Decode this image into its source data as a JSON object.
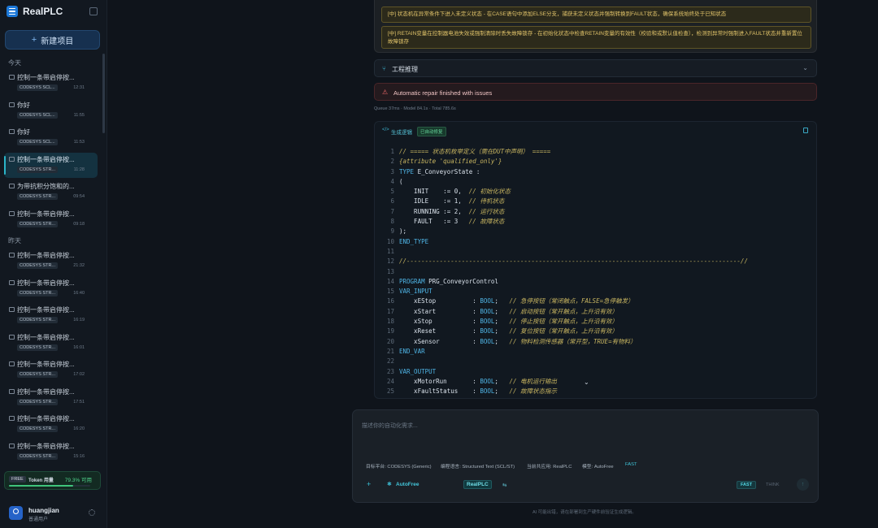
{
  "app": {
    "name": "RealPLC",
    "new_project_label": "新建项目"
  },
  "history": {
    "sections": [
      {
        "label": "今天",
        "items": [
          {
            "title": "控制一条带启停按...",
            "tag": "CODESYS SCL...",
            "time": "12:31",
            "active": false
          },
          {
            "title": "你好",
            "tag": "CODESYS SCL...",
            "time": "11:55",
            "active": false
          },
          {
            "title": "你好",
            "tag": "CODESYS SCL...",
            "time": "11:53",
            "active": false
          },
          {
            "title": "控制一条带启停按...",
            "tag": "CODESYS STR...",
            "time": "11:28",
            "active": true
          },
          {
            "title": "为带抗积分饱和的...",
            "tag": "CODESYS STR...",
            "time": "09:54",
            "active": false
          },
          {
            "title": "控制一条带启停按...",
            "tag": "CODESYS STR...",
            "time": "09:18",
            "active": false
          }
        ]
      },
      {
        "label": "昨天",
        "items": [
          {
            "title": "控制一条带启停按...",
            "tag": "CODESYS STR...",
            "time": "21:32",
            "active": false
          },
          {
            "title": "控制一条带启停按...",
            "tag": "CODESYS STR...",
            "time": "16:40",
            "active": false
          },
          {
            "title": "控制一条带启停按...",
            "tag": "CODESYS STR...",
            "time": "16:19",
            "active": false
          },
          {
            "title": "控制一条带启停按...",
            "tag": "CODESYS STR...",
            "time": "16:01",
            "active": false
          },
          {
            "title": "控制一条带启停按...",
            "tag": "CODESYS STR...",
            "time": "17:02",
            "active": false
          },
          {
            "title": "控制一条带启停按...",
            "tag": "CODESYS STR...",
            "time": "17:51",
            "active": false
          },
          {
            "title": "控制一条带启停按...",
            "tag": "CODESYS STR...",
            "time": "16:20",
            "active": false
          },
          {
            "title": "控制一条带启停按...",
            "tag": "CODESYS STR...",
            "time": "15:16",
            "active": false
          }
        ]
      }
    ]
  },
  "token": {
    "plan": "FREE",
    "label": "Token 用量",
    "percent_text": "79.3% 可用",
    "available_fraction": 0.793
  },
  "user": {
    "name": "huangjian",
    "role": "普通用户"
  },
  "warnings": [
    "[中] 状态机在异常条件下进入未定义状态 - 在CASE语句中添加ELSE分支，捕获未定义状态并强制转换到FAULT状态，确保系统始终处于已知状态",
    "[中] RETAIN变量在控制器电池失效或强制清除时丢失故障锁存 - 在初始化状态中检查RETAIN变量的有效性（校验和或默认值检查），检测到异常时强制进入FAULT状态并重新置位故障锁存"
  ],
  "engineering": {
    "label": "工程推理"
  },
  "repair": {
    "text": "Automatic repair finished with issues"
  },
  "stats": {
    "text": "Queue 37ms · Model 84.1s · Total 785.6s"
  },
  "code_panel": {
    "title": "生成逻辑",
    "badge": "已自动修复",
    "lines": [
      {
        "n": "1",
        "segs": [
          {
            "t": "// ===== 状态机枚举定义（需在DUT中声明） =====",
            "c": "cm"
          }
        ]
      },
      {
        "n": "2",
        "segs": [
          {
            "t": "{attribute 'qualified_only'}",
            "c": "cm"
          }
        ]
      },
      {
        "n": "3",
        "segs": [
          {
            "t": "TYPE",
            "c": "kw"
          },
          {
            "t": " E_ConveyorState :",
            "c": "id"
          }
        ]
      },
      {
        "n": "4",
        "segs": [
          {
            "t": "(",
            "c": "id"
          }
        ]
      },
      {
        "n": "5",
        "segs": [
          {
            "t": "    INIT    := 0,  ",
            "c": "id"
          },
          {
            "t": "// 初始化状态",
            "c": "cm"
          }
        ]
      },
      {
        "n": "6",
        "segs": [
          {
            "t": "    IDLE    := 1,  ",
            "c": "id"
          },
          {
            "t": "// 待机状态",
            "c": "cm"
          }
        ]
      },
      {
        "n": "7",
        "segs": [
          {
            "t": "    RUNNING := 2,  ",
            "c": "id"
          },
          {
            "t": "// 运行状态",
            "c": "cm"
          }
        ]
      },
      {
        "n": "8",
        "segs": [
          {
            "t": "    FAULT   := 3   ",
            "c": "id"
          },
          {
            "t": "// 故障状态",
            "c": "cm"
          }
        ]
      },
      {
        "n": "9",
        "segs": [
          {
            "t": ");",
            "c": "id"
          }
        ]
      },
      {
        "n": "10",
        "segs": [
          {
            "t": "END_TYPE",
            "c": "kw"
          }
        ]
      },
      {
        "n": "11",
        "segs": [
          {
            "t": "",
            "c": "id"
          }
        ]
      },
      {
        "n": "12",
        "segs": [
          {
            "t": "//-------------------------------------------------------------------------------------------//",
            "c": "cm"
          }
        ]
      },
      {
        "n": "13",
        "segs": [
          {
            "t": "",
            "c": "id"
          }
        ]
      },
      {
        "n": "14",
        "segs": [
          {
            "t": "PROGRAM",
            "c": "kw"
          },
          {
            "t": " PRG_ConveyorControl",
            "c": "id"
          }
        ]
      },
      {
        "n": "15",
        "segs": [
          {
            "t": "VAR_INPUT",
            "c": "kw"
          }
        ]
      },
      {
        "n": "16",
        "segs": [
          {
            "t": "    xEStop          : ",
            "c": "id"
          },
          {
            "t": "BOOL",
            "c": "ty"
          },
          {
            "t": ";   ",
            "c": "id"
          },
          {
            "t": "// 急停按钮（常闭触点，FALSE=急停触发）",
            "c": "cm"
          }
        ]
      },
      {
        "n": "17",
        "segs": [
          {
            "t": "    xStart          : ",
            "c": "id"
          },
          {
            "t": "BOOL",
            "c": "ty"
          },
          {
            "t": ";   ",
            "c": "id"
          },
          {
            "t": "// 启动按钮（常开触点，上升沿有效）",
            "c": "cm"
          }
        ]
      },
      {
        "n": "18",
        "segs": [
          {
            "t": "    xStop           : ",
            "c": "id"
          },
          {
            "t": "BOOL",
            "c": "ty"
          },
          {
            "t": ";   ",
            "c": "id"
          },
          {
            "t": "// 停止按钮（常开触点，上升沿有效）",
            "c": "cm"
          }
        ]
      },
      {
        "n": "19",
        "segs": [
          {
            "t": "    xReset          : ",
            "c": "id"
          },
          {
            "t": "BOOL",
            "c": "ty"
          },
          {
            "t": ";   ",
            "c": "id"
          },
          {
            "t": "// 复位按钮（常开触点，上升沿有效）",
            "c": "cm"
          }
        ]
      },
      {
        "n": "20",
        "segs": [
          {
            "t": "    xSensor         : ",
            "c": "id"
          },
          {
            "t": "BOOL",
            "c": "ty"
          },
          {
            "t": ";   ",
            "c": "id"
          },
          {
            "t": "// 物料检测传感器（常开型，TRUE=有物料）",
            "c": "cm"
          }
        ]
      },
      {
        "n": "21",
        "segs": [
          {
            "t": "END_VAR",
            "c": "kw"
          }
        ]
      },
      {
        "n": "22",
        "segs": [
          {
            "t": "",
            "c": "id"
          }
        ]
      },
      {
        "n": "23",
        "segs": [
          {
            "t": "VAR_OUTPUT",
            "c": "kw"
          }
        ]
      },
      {
        "n": "24",
        "segs": [
          {
            "t": "    xMotorRun       : ",
            "c": "id"
          },
          {
            "t": "BOOL",
            "c": "ty"
          },
          {
            "t": ";   ",
            "c": "id"
          },
          {
            "t": "// 电机运行输出",
            "c": "cm"
          }
        ]
      },
      {
        "n": "25",
        "segs": [
          {
            "t": "    xFaultStatus    : ",
            "c": "id"
          },
          {
            "t": "BOOL",
            "c": "ty"
          },
          {
            "t": ";   ",
            "c": "id"
          },
          {
            "t": "// 故障状态指示",
            "c": "cm"
          }
        ]
      }
    ]
  },
  "composer": {
    "placeholder": "描述你的自动化需求...",
    "meta": [
      {
        "key": "target",
        "text": "目标平台: CODESYS (Generic)"
      },
      {
        "key": "language",
        "text": "编程语言: Structured Text (SCL/ST)"
      },
      {
        "key": "app",
        "text": "当前共应用: RealPLC"
      },
      {
        "key": "model",
        "text": "模型: AutoFree"
      },
      {
        "key": "speed",
        "text": "FAST"
      }
    ],
    "model_name": "AutoFree",
    "platform_chip": "RealPLC",
    "fast_label": "FAST",
    "think_label": "THINK"
  },
  "footer": {
    "disclaimer": "AI 可能出错，请在部署到生产硬件前验证生成逻辑。"
  },
  "colors": {
    "keyword": "#4fb5e6",
    "comment": "#c8b560",
    "type": "#4fb5e6",
    "ident": "#d9e1ea",
    "accent": "#2bb5c8",
    "warning": "#e2c46a",
    "error": "#f06b6b"
  },
  "icons": [
    "brand-logo",
    "collapse-sidebar-icon",
    "plus-icon",
    "chat-icon",
    "gear-icon",
    "branch-icon",
    "chevron-down-icon",
    "alert-icon",
    "code-icon",
    "copy-icon",
    "sparkle-icon",
    "swap-icon",
    "send-icon"
  ]
}
